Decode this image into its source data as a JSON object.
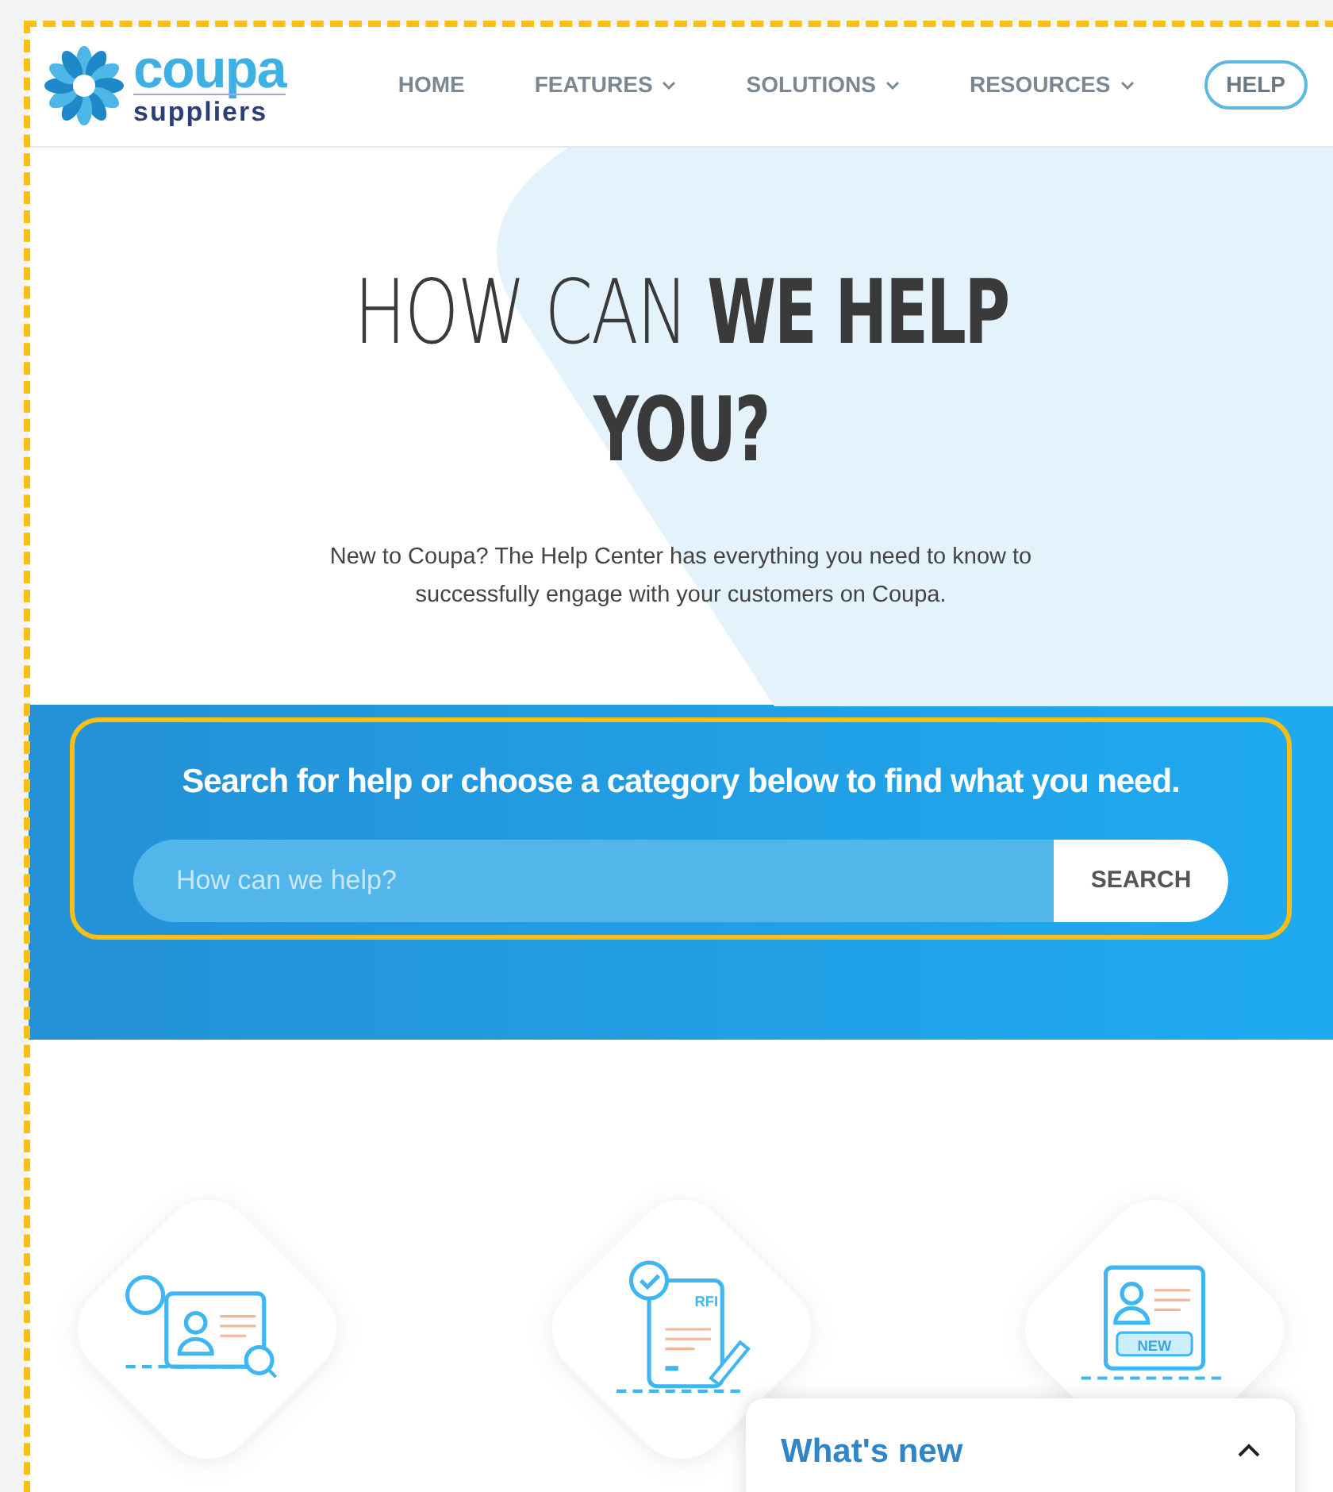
{
  "logo": {
    "name": "coupa",
    "tagline": "suppliers"
  },
  "nav": [
    {
      "label": "HOME",
      "dropdown": false,
      "kind": "link"
    },
    {
      "label": "FEATURES",
      "dropdown": true,
      "kind": "link"
    },
    {
      "label": "SOLUTIONS",
      "dropdown": true,
      "kind": "link"
    },
    {
      "label": "RESOURCES",
      "dropdown": true,
      "kind": "link"
    },
    {
      "label": "HELP",
      "dropdown": false,
      "kind": "pill"
    }
  ],
  "hero": {
    "title_light": "HOW CAN",
    "title_bold": "WE HELP",
    "title_line2": "YOU?",
    "intro": "New to Coupa? The Help Center has everything you need to know to successfully engage with your customers on Coupa."
  },
  "search": {
    "heading": "Search for help or choose a category below to find what you need.",
    "placeholder": "How can we help?",
    "button": "SEARCH"
  },
  "categories": [
    {
      "kind": "profile"
    },
    {
      "kind": "rfi",
      "label": "RFI"
    },
    {
      "kind": "new",
      "label": "NEW"
    }
  ],
  "whats_new": {
    "title": "What's new",
    "expanded": false
  }
}
